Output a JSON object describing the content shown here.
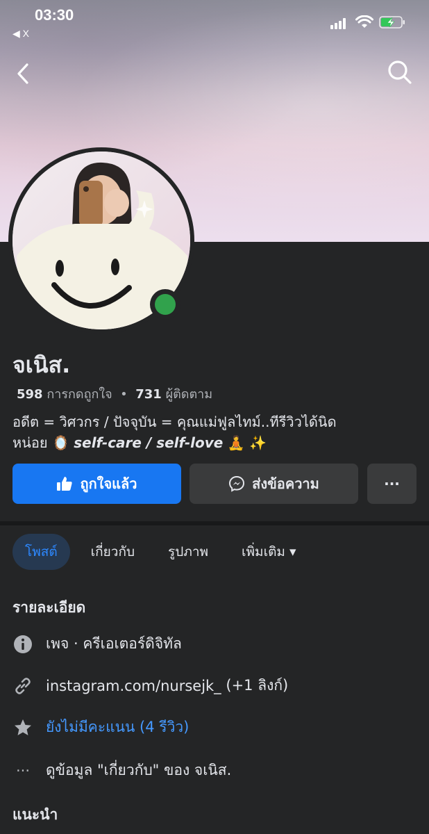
{
  "status": {
    "time": "03:30",
    "back_app": "◀ X"
  },
  "profile": {
    "name": "จเนิส.",
    "likes_count": "598",
    "likes_label": "การกดถูกใจ",
    "separator": "•",
    "followers_count": "731",
    "followers_label": "ผู้ติดตาม",
    "bio_line1": "อดีต = วิศวกร / ปัจจุบัน = คุณแม่ฟูลไทม์..ทีรีวิวได้นิด",
    "bio_line2_prefix": "หน่อย 🪞",
    "bio_line2_italic": "self-care / self-love",
    "bio_line2_suffix": "🧘 ✨"
  },
  "actions": {
    "like_label": "ถูกใจแล้ว",
    "message_label": "ส่งข้อความ",
    "more_label": "···"
  },
  "tabs": [
    {
      "label": "โพสต์",
      "active": true
    },
    {
      "label": "เกี่ยวกับ",
      "active": false
    },
    {
      "label": "รูปภาพ",
      "active": false
    },
    {
      "label": "เพิ่มเติม ▾",
      "active": false
    }
  ],
  "details": {
    "title": "รายละเอียด",
    "page_type": "เพจ · ครีเอเตอร์ดิจิทัล",
    "link": "instagram.com/nursejk_",
    "link_extra": "(+1 ลิงก์)",
    "rating": "ยังไม่มีคะแนน (4 รีวิว)",
    "see_about": "ดูข้อมูล \"เกี่ยวกับ\" ของ จเนิส.",
    "more_icon": "···"
  },
  "recommend": {
    "title": "แนะนำ"
  },
  "colors": {
    "background": "#242526",
    "primary_button": "#1877f2",
    "secondary_button": "#3a3b3c",
    "active_tab_bg": "#263951",
    "active_tab_text": "#2d88ff",
    "link_blue": "#4599ff",
    "online_green": "#31a24c"
  },
  "icons": [
    "back-arrow-icon",
    "search-icon",
    "thumbs-up-icon",
    "messenger-icon",
    "info-icon",
    "link-icon",
    "star-icon",
    "ellipsis-icon",
    "chevron-down-icon"
  ]
}
